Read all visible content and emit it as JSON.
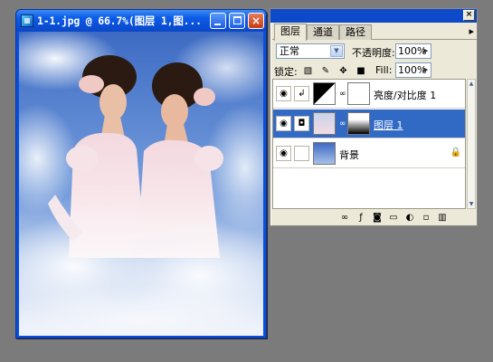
{
  "document_window": {
    "title": "1-1.jpg @ 66.7%(图层 1,图...",
    "buttons": {
      "minimize": "minimize",
      "maximize": "maximize",
      "close": "×"
    },
    "image_description_icon": "photo-canvas"
  },
  "layers_palette": {
    "close_label": "×",
    "tabs": [
      {
        "label": "图层",
        "active": true
      },
      {
        "label": "通道",
        "active": false
      },
      {
        "label": "路径",
        "active": false
      }
    ],
    "menu_icon": "▸",
    "blend_mode": "正常",
    "opacity_label": "不透明度:",
    "opacity_value": "100%",
    "lock_label": "锁定:",
    "fill_label": "Fill:",
    "fill_value": "100%",
    "layers": [
      {
        "name": "亮度/对比度 1",
        "selected": false,
        "visible": true,
        "type": "adjustment"
      },
      {
        "name": "图层 1",
        "selected": true,
        "visible": true,
        "type": "layer-with-mask"
      },
      {
        "name": "背景",
        "selected": false,
        "visible": true,
        "type": "background-locked"
      }
    ]
  },
  "colors": {
    "desktop": "#7b7b7b",
    "xp_title_blue": "#0a4fd8",
    "panel_bg": "#ece9d8",
    "selection_blue": "#316ac5",
    "close_red": "#c43c12"
  }
}
